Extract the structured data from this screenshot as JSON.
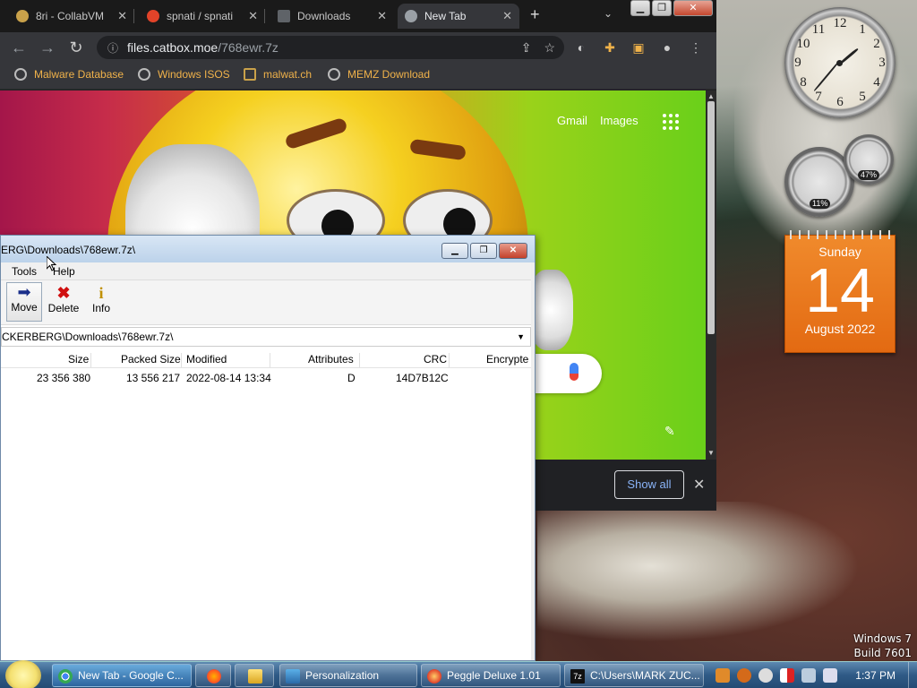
{
  "desktop": {
    "windows_version": "Windows 7",
    "build": "Build 7601"
  },
  "gadgets": {
    "clock_numbers": [
      "12",
      "1",
      "2",
      "3",
      "4",
      "5",
      "6",
      "7",
      "8",
      "9",
      "10",
      "11"
    ],
    "cpu_percent": "11%",
    "mem_percent": "47%",
    "calendar": {
      "day": "Sunday",
      "date": "14",
      "month": "August 2022"
    }
  },
  "chrome": {
    "tabs": [
      {
        "label": "8ri - CollabVM",
        "active": false
      },
      {
        "label": "spnati / spnati",
        "active": false
      },
      {
        "label": "Downloads",
        "active": false
      },
      {
        "label": "New Tab",
        "active": true
      }
    ],
    "url_host": "files.catbox.moe",
    "url_path": "/768ewr.7z",
    "bookmarks": [
      "Malware Database",
      "Windows ISOS",
      "malwat.ch",
      "MEMZ Download"
    ],
    "google_links": {
      "gmail": "Gmail",
      "images": "Images"
    },
    "download_bar": {
      "show_all": "Show all"
    }
  },
  "zip": {
    "title": "ERG\\Downloads\\768ewr.7z\\",
    "menu": {
      "tools": "Tools",
      "help": "Help"
    },
    "toolbar": {
      "move": "Move",
      "delete": "Delete",
      "info": "Info"
    },
    "path": "CKERBERG\\Downloads\\768ewr.7z\\",
    "columns": {
      "size": "Size",
      "packed": "Packed Size",
      "modified": "Modified",
      "attributes": "Attributes",
      "crc": "CRC",
      "encrypted": "Encrypte"
    },
    "rows": [
      {
        "size": "23 356 380",
        "packed": "13 556 217",
        "modified": "2022-08-14 13:34",
        "attributes": "D",
        "crc": "14D7B12C"
      }
    ]
  },
  "taskbar": {
    "items": [
      {
        "label": "New Tab - Google C..."
      },
      {
        "label": ""
      },
      {
        "label": ""
      },
      {
        "label": "Personalization"
      },
      {
        "label": "Peggle Deluxe 1.01"
      },
      {
        "label": "C:\\Users\\MARK ZUC..."
      }
    ],
    "time": "1:37 PM"
  }
}
